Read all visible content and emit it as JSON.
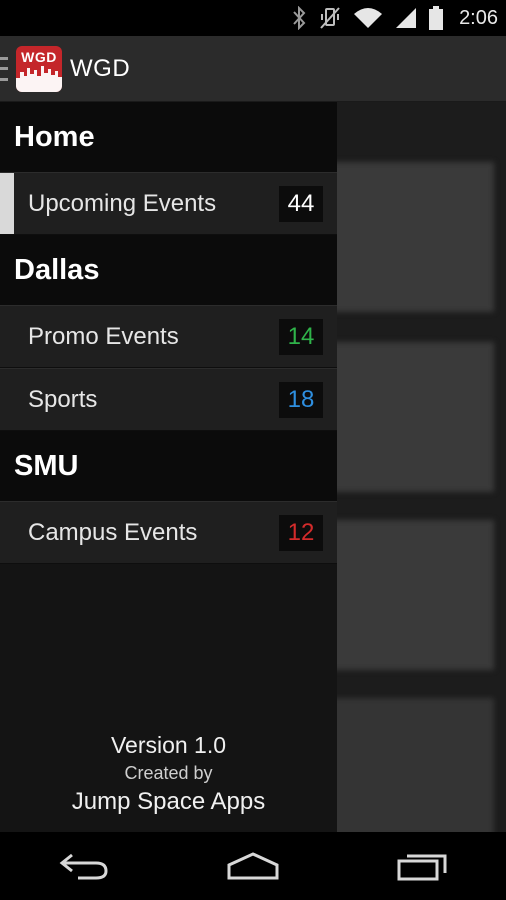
{
  "status_bar": {
    "time": "2:06",
    "icons": [
      "bluetooth-icon",
      "vibrate-off-icon",
      "wifi-icon",
      "cell-signal-icon",
      "battery-icon"
    ]
  },
  "action_bar": {
    "logo_text": "WGD",
    "title": "WGD"
  },
  "drawer": {
    "sections": [
      {
        "title": "Home",
        "items": [
          {
            "label": "Upcoming Events",
            "count": "44",
            "count_color": "#ffffff",
            "active": true
          }
        ]
      },
      {
        "title": "Dallas",
        "items": [
          {
            "label": "Promo Events",
            "count": "14",
            "count_color": "#2fb34a"
          },
          {
            "label": "Sports",
            "count": "18",
            "count_color": "#2e8fe0"
          }
        ]
      },
      {
        "title": "SMU",
        "items": [
          {
            "label": "Campus Events",
            "count": "12",
            "count_color": "#d32b2b"
          }
        ]
      }
    ],
    "footer": {
      "version": "Version 1.0",
      "created_by": "Created by",
      "company": "Jump Space Apps"
    }
  },
  "nav_bar": {
    "icons": [
      "back-icon",
      "home-icon",
      "recent-apps-icon"
    ]
  },
  "colors": {
    "accent_red": "#c4262a",
    "promo_green": "#2fb34a",
    "sports_blue": "#2e8fe0",
    "campus_red": "#d32b2b"
  }
}
